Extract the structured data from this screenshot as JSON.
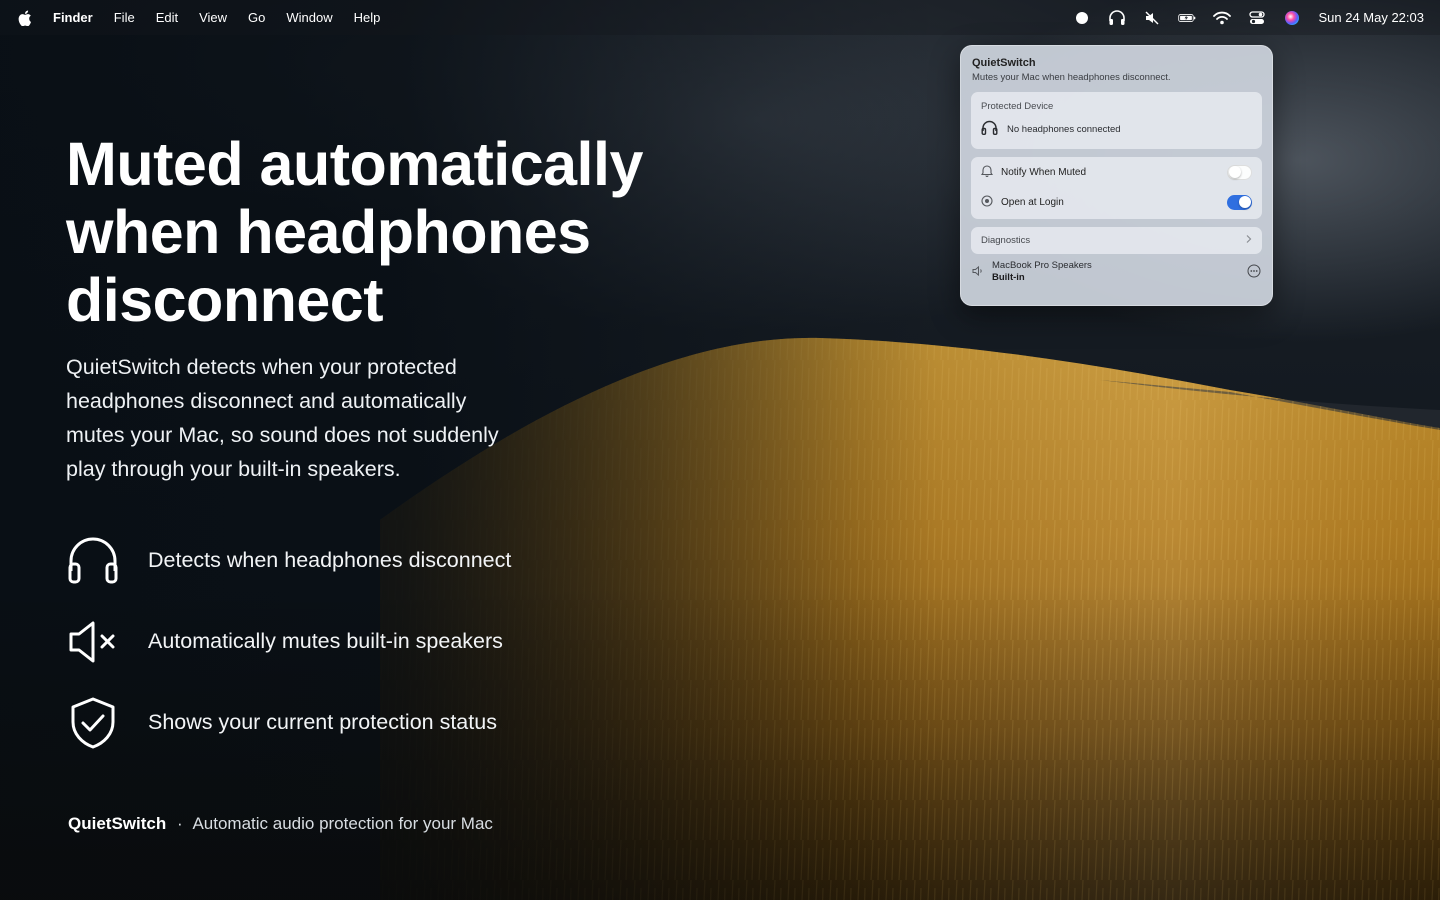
{
  "menubar": {
    "app_name": "Finder",
    "menus": [
      "File",
      "Edit",
      "View",
      "Go",
      "Window",
      "Help"
    ],
    "status_icons": [
      "record-icon",
      "headphones-icon",
      "speaker-muted-icon",
      "battery-charging-icon",
      "wifi-icon",
      "control-center-icon",
      "siri-icon"
    ],
    "clock": "Sun 24 May  22:03"
  },
  "hero": {
    "headline_line1": "Muted automatically",
    "headline_line2": "when headphones",
    "headline_line3": "disconnect",
    "description": "QuietSwitch detects when your protected headphones disconnect and automatically mutes your Mac, so sound does not suddenly play through your built-in speakers."
  },
  "features": [
    {
      "icon": "headphones-icon",
      "label": "Detects when headphones disconnect"
    },
    {
      "icon": "speaker-muted-icon",
      "label": "Automatically mutes built-in speakers"
    },
    {
      "icon": "shield-check-icon",
      "label": "Shows your current protection status"
    }
  ],
  "footer": {
    "brand": "QuietSwitch",
    "separator": "·",
    "tagline": "Automatic audio protection for your Mac"
  },
  "popover": {
    "title": "QuietSwitch",
    "subtitle": "Mutes your Mac when headphones disconnect.",
    "protected_device": {
      "label": "Protected Device",
      "status": "No headphones connected"
    },
    "toggles": [
      {
        "label": "Notify When Muted",
        "on": false
      },
      {
        "label": "Open at Login",
        "on": true
      }
    ],
    "diagnostics_label": "Diagnostics",
    "output": {
      "name": "MacBook Pro Speakers",
      "type": "Built-in"
    }
  },
  "colors": {
    "accent": "#2f6fe0",
    "wheat": "#c8922a",
    "sky": "#161c23"
  }
}
